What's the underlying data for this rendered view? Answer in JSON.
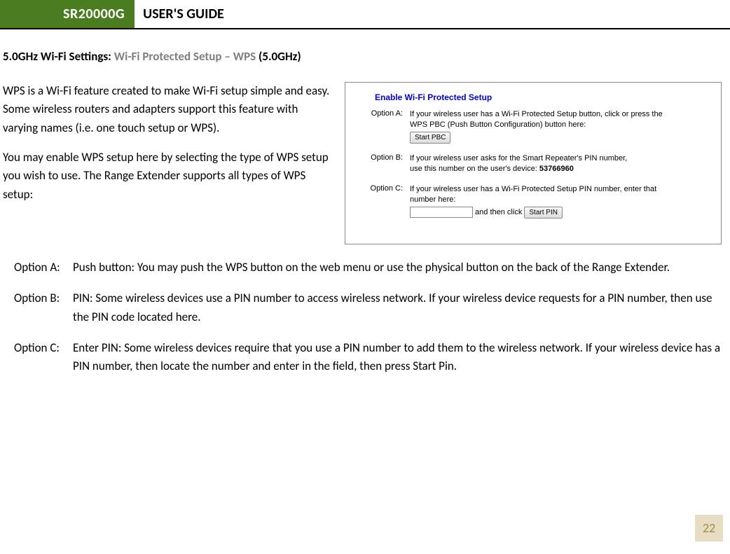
{
  "header": {
    "product": "SR20000G",
    "title": "USER'S GUIDE"
  },
  "section": {
    "prefix": "5.0GHz Wi-Fi Settings: ",
    "gray": "Wi-Fi Protected Setup – WPS ",
    "suffix": "(5.0GHz)"
  },
  "paragraphs": {
    "p1": "WPS is a Wi-Fi feature created to make Wi-Fi setup simple and easy. Some wireless routers and adapters support this feature with varying names (i.e. one touch setup or WPS).",
    "p2": "You may enable WPS setup here by selecting the type of WPS setup you wish to use. The Range Extender supports all types of WPS setup:"
  },
  "screenshot": {
    "title": "Enable Wi-Fi Protected Setup",
    "optA": {
      "label": "Option A:",
      "line1": "If your wireless user has a Wi-Fi Protected Setup button, click or press the",
      "line2": "WPS PBC (Push Button Configuration) button here:",
      "button": "Start PBC"
    },
    "optB": {
      "label": "Option B:",
      "line1": "If your wireless user asks for the Smart Repeater's PIN number,",
      "line2_prefix": "use this number on the user's device:  ",
      "pin": "53766960"
    },
    "optC": {
      "label": "Option C:",
      "line1": "If your wireless user has a Wi-Fi Protected Setup PIN number, enter that",
      "line2": "number here:",
      "mid_text": " and then click ",
      "button": "Start PIN"
    }
  },
  "options": {
    "a": {
      "label": "Option A:",
      "text": "Push button: You may push the WPS button on the web menu or use the physical button on the back of the Range Extender."
    },
    "b": {
      "label": "Option B:",
      "text": "PIN: Some wireless devices use a PIN number to access wireless network. If your wireless device requests for a PIN number, then use the PIN code located here."
    },
    "c": {
      "label": "Option C:",
      "text": "Enter PIN: Some wireless devices require that you use a PIN number to add them to the wireless network. If your wireless device has a PIN number, then locate the number and enter in the field, then press Start Pin."
    }
  },
  "page_number": "22"
}
